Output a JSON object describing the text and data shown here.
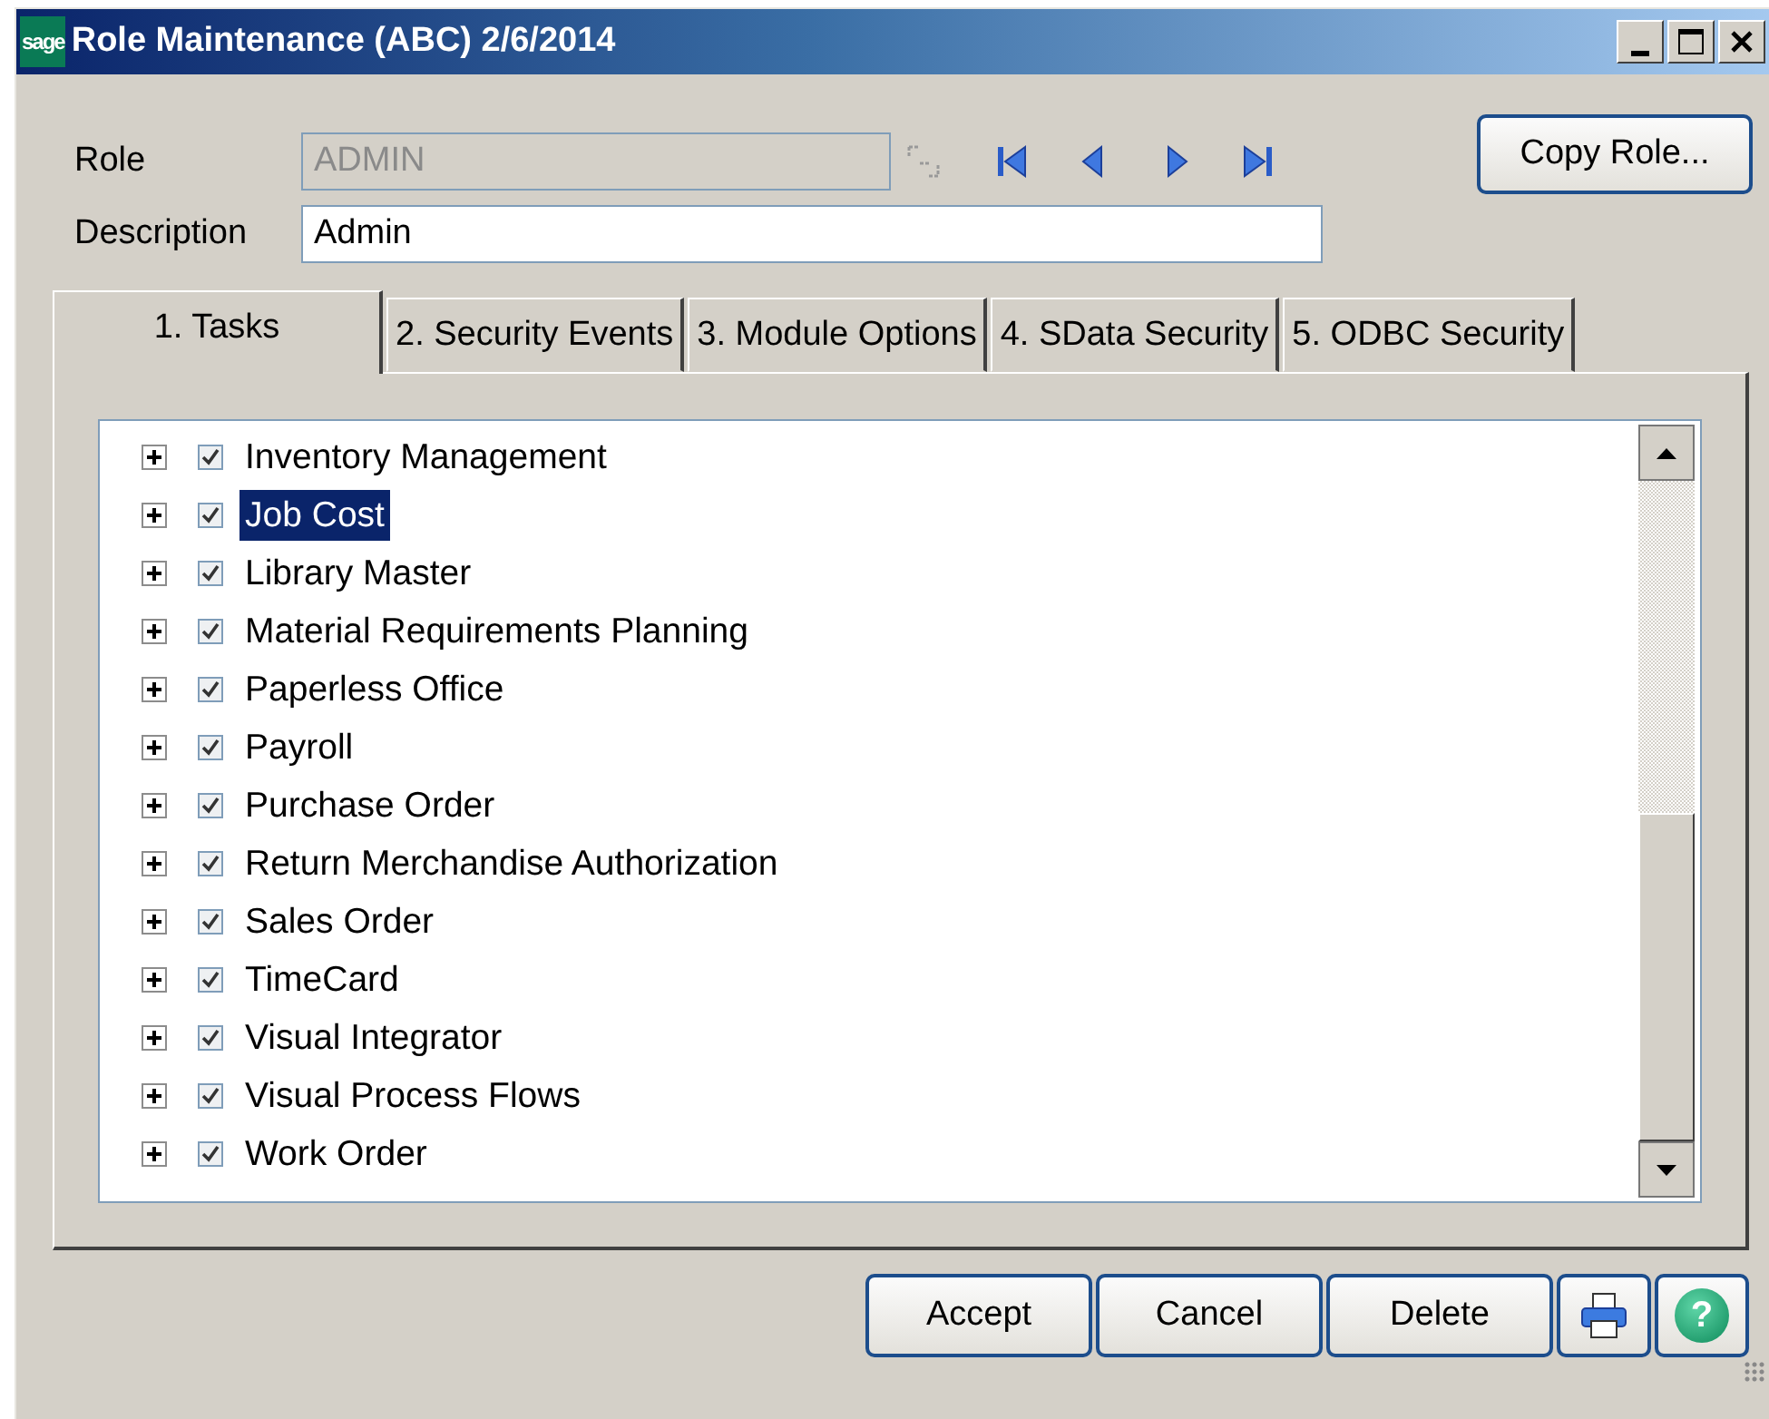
{
  "window": {
    "logo": "sage",
    "title": "Role Maintenance (ABC) 2/6/2014"
  },
  "fields": [
    {
      "label": "Role",
      "value": "ADMIN",
      "disabled": true,
      "kind": "lookup"
    },
    {
      "label": "Description",
      "value": "Admin",
      "disabled": false,
      "kind": "text"
    }
  ],
  "copy_button": "Copy Role...",
  "tabs": [
    {
      "label": "1. Tasks",
      "selected": true
    },
    {
      "label": "2. Security Events",
      "selected": false
    },
    {
      "label": "3. Module Options",
      "selected": false
    },
    {
      "label": "4. SData Security",
      "selected": false
    },
    {
      "label": "5. ODBC Security",
      "selected": false
    }
  ],
  "tree": [
    {
      "label": "Inventory Management",
      "checked": true,
      "expanded": false,
      "selected": false
    },
    {
      "label": "Job Cost",
      "checked": true,
      "expanded": false,
      "selected": true
    },
    {
      "label": "Library Master",
      "checked": true,
      "expanded": false,
      "selected": false
    },
    {
      "label": "Material Requirements Planning",
      "checked": true,
      "expanded": false,
      "selected": false
    },
    {
      "label": "Paperless Office",
      "checked": true,
      "expanded": false,
      "selected": false
    },
    {
      "label": "Payroll",
      "checked": true,
      "expanded": false,
      "selected": false
    },
    {
      "label": "Purchase Order",
      "checked": true,
      "expanded": false,
      "selected": false
    },
    {
      "label": "Return Merchandise Authorization",
      "checked": true,
      "expanded": false,
      "selected": false
    },
    {
      "label": "Sales Order",
      "checked": true,
      "expanded": false,
      "selected": false
    },
    {
      "label": "TimeCard",
      "checked": true,
      "expanded": false,
      "selected": false
    },
    {
      "label": "Visual Integrator",
      "checked": true,
      "expanded": false,
      "selected": false
    },
    {
      "label": "Visual Process Flows",
      "checked": true,
      "expanded": false,
      "selected": false
    },
    {
      "label": "Work Order",
      "checked": true,
      "expanded": false,
      "selected": false
    }
  ],
  "buttons": [
    "Accept",
    "Cancel",
    "Delete"
  ],
  "help_button": "?"
}
